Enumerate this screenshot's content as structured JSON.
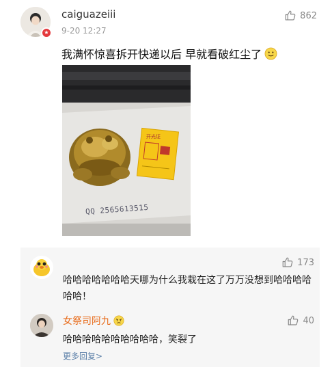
{
  "post": {
    "username": "caiguazeiii",
    "timestamp": "9-20 12:27",
    "likes": "862",
    "text": "我满怀惊喜拆开快递以后 早就看破红尘了",
    "photo": {
      "qq_text": "QQ 2565613515",
      "card_text": "开光证"
    }
  },
  "comments": [
    {
      "likes": "173",
      "text": "哈哈哈哈哈哈哈天哪为什么我栽在这了万万没想到哈哈哈哈哈哈！"
    }
  ],
  "reply": {
    "username": "女祭司阿九",
    "likes": "40",
    "text": "哈哈哈哈哈哈哈哈哈哈，笑裂了",
    "more_replies": "更多回复>"
  },
  "colors": {
    "accent_name": "#e86b1a",
    "link": "#5b7fa8",
    "badge": "#e4393c"
  },
  "icons": [
    "thumbs-up-icon",
    "smile-emoji-icon",
    "verified-badge-icon"
  ]
}
